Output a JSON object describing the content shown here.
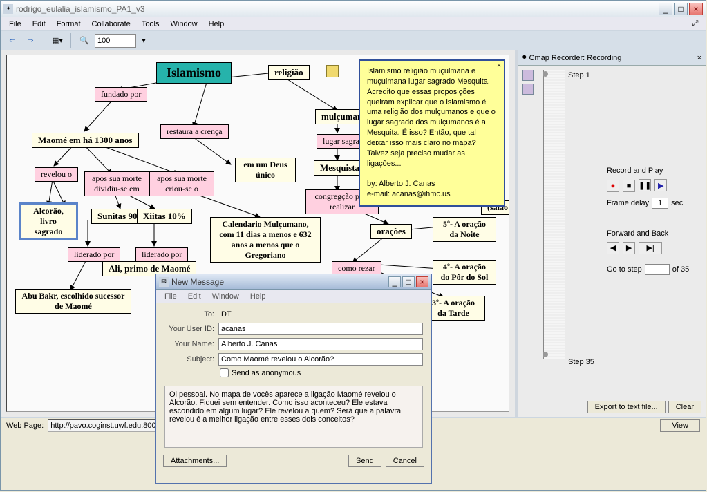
{
  "window": {
    "title": "rodrigo_eulalia_islamismo_PA1_v3"
  },
  "menu": {
    "file": "File",
    "edit": "Edit",
    "format": "Format",
    "collaborate": "Collaborate",
    "tools": "Tools",
    "window": "Window",
    "help": "Help"
  },
  "toolbar": {
    "zoom": "100"
  },
  "status": {
    "label": "Web Page:",
    "url": "http://pavo.coginst.uwf.edu:8001/servlet/",
    "view": "View"
  },
  "map": {
    "main": "Islamismo",
    "religiao": "religião",
    "mulcumana": "mulçumana",
    "fundado": "fundado por",
    "maome": "Maomé em há 1300 anos",
    "restaura": "restaura  a crença",
    "deus": "em  um Deus único",
    "lugar": "lugar sagrado",
    "mesquista": "Mesquista",
    "congreg": "congregção para realizar",
    "oracoes": "orações",
    "comorezar": "como rezar",
    "revelou": "revelou o",
    "apos1": "apos sua morte dividiu-se em",
    "apos2": "apos sua morte criou-se o",
    "alcorao": "Alcorão, livro sagrado",
    "sunitas": "Sunitas 90%",
    "xiitas": "Xiitas 10%",
    "lider1": "liderado por",
    "lider2": "liderado por",
    "calend": "Calendario Mulçumano, com 11 dias a menos e 632 anos a menos que o Gregoriano",
    "ali": "Ali, primo de Maomé",
    "abu": "Abu Bakr, escolhido sucessor de Maomé",
    "or5": "5º- A oração da Noite",
    "or4": "4º- A oração do Pôr do Sol",
    "or3": "3º- A oração da Tarde",
    "salao": "(salão"
  },
  "note": {
    "body": "Islamismo religião muçulmana e muçulmana lugar sagrado Mesquita. Acredito que essas proposições queiram explicar que o islamismo é uma religião dos mulçumanos e que o lugar sagrado dos mulçumanos é a Mesquita. É isso? Então, que tal deixar isso mais claro no mapa? Talvez seja preciso mudar as ligações...",
    "by": "by: Alberto J. Canas",
    "email": "e-mail: acanas@ihmc.us"
  },
  "recorder": {
    "title": "Cmap Recorder: Recording",
    "step1": "Step 1",
    "step35": "Step 35",
    "record_play": "Record and Play",
    "frame_delay": "Frame delay",
    "frame_val": "1",
    "sec": "sec",
    "forward_back": "Forward and Back",
    "goto": "Go to step",
    "of35": "of  35",
    "export": "Export to text file...",
    "clear": "Clear"
  },
  "dialog": {
    "title": "New Message",
    "menu": {
      "file": "File",
      "edit": "Edit",
      "window": "Window",
      "help": "Help"
    },
    "to_lbl": "To:",
    "to_val": "DT",
    "uid_lbl": "Your User ID:",
    "uid_val": "acanas",
    "name_lbl": "Your Name:",
    "name_val": "Alberto J. Canas",
    "subj_lbl": "Subject:",
    "subj_val": "Como Maomé revelou o Alcorão?",
    "anon": "Send as anonymous",
    "body": "Oi pessoal. No mapa de vocês aparece a ligação Maomé revelou o Alcorão. Fiquei sem entender. Como isso aconteceu? Ele estava escondido em algum lugar? Ele revelou a quem? Será que a palavra revelou é a melhor ligação entre esses dois conceitos?",
    "attach": "Attachments...",
    "send": "Send",
    "cancel": "Cancel"
  }
}
